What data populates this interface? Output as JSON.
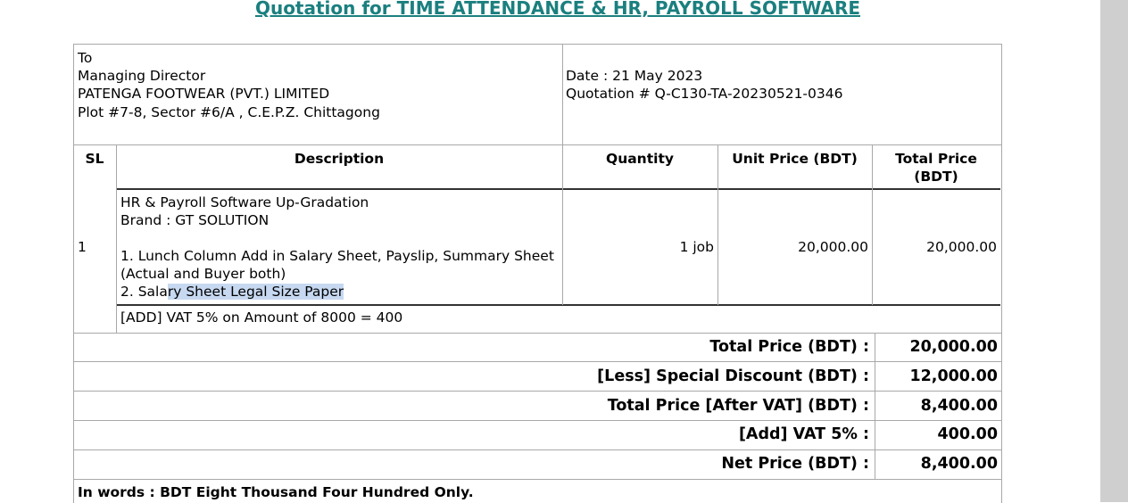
{
  "title": "Quotation for TIME ATTENDANCE & HR, PAYROLL SOFTWARE",
  "recipient": {
    "to": "To",
    "designation": "Managing Director",
    "company": "PATENGA FOOTWEAR (PVT.) LIMITED",
    "address": "Plot #7-8, Sector #6/A , C.E.P.Z. Chittagong"
  },
  "meta": {
    "date": "Date : 21 May 2023",
    "quotation_no": "Quotation # Q-C130-TA-20230521-0346"
  },
  "table": {
    "headers": {
      "sl": "SL",
      "description": "Description",
      "quantity": "Quantity",
      "unit_price": "Unit Price (BDT)",
      "total_price_line1": "Total Price",
      "total_price_line2": "(BDT)"
    },
    "item": {
      "sl": "1",
      "desc_line1": "HR & Payroll Software Up-Gradation",
      "desc_line2": "Brand : GT SOLUTION",
      "desc_line3": "1. Lunch Column Add in Salary Sheet, Payslip, Summary Sheet",
      "desc_line4": "(Actual and Buyer both)",
      "desc_line5_plain": "2. Sala",
      "desc_line5_selected": "ry Sheet Legal Size Paper",
      "quantity": "1 job",
      "unit_price": "20,000.00",
      "total_price": "20,000.00"
    },
    "vat_note": "[ADD] VAT 5% on Amount of 8000 = 400"
  },
  "summary": [
    {
      "label": "Total Price (BDT) :",
      "value": "20,000.00"
    },
    {
      "label": "[Less] Special Discount (BDT) :",
      "value": "12,000.00"
    },
    {
      "label": "Total Price [After VAT] (BDT) :",
      "value": "8,400.00"
    },
    {
      "label": "[Add] VAT 5% :",
      "value": "400.00"
    },
    {
      "label": "Net Price (BDT) :",
      "value": "8,400.00"
    }
  ],
  "in_words": "In words : BDT Eight Thousand Four Hundred Only."
}
